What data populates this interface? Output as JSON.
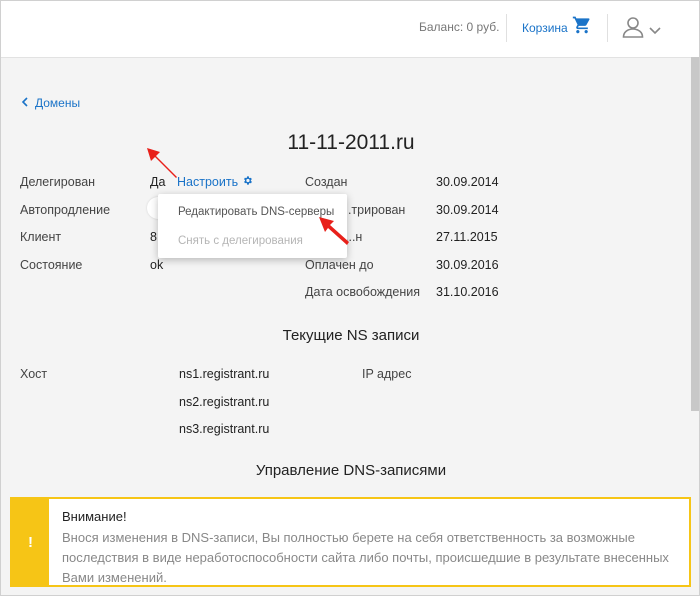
{
  "header": {
    "balance": "Баланс: 0 руб.",
    "cart_label": "Корзина"
  },
  "nav": {
    "back_label": "Домены"
  },
  "domain": {
    "title": "11-11-2011.ru"
  },
  "left_fields": [
    {
      "label": "Делегирован",
      "value": "Да"
    },
    {
      "label": "Автопродление",
      "value": ""
    },
    {
      "label": "Клиент",
      "value": "8"
    },
    {
      "label": "Состояние",
      "value": "ok"
    }
  ],
  "configure_link": "Настроить",
  "right_fields": [
    {
      "label": "Создан",
      "value": "30.09.2014"
    },
    {
      "label": "...трирован",
      "value": "30.09.2014"
    },
    {
      "label": "...н",
      "value": "27.11.2015"
    },
    {
      "label": "Оплачен до",
      "value": "30.09.2016"
    },
    {
      "label": "Дата освобождения",
      "value": "31.10.2016"
    }
  ],
  "dropdown": {
    "items": [
      {
        "label": "Редактировать DNS-серверы",
        "enabled": true
      },
      {
        "label": "Снять с делегирования",
        "enabled": false
      }
    ]
  },
  "ns_section": {
    "title": "Текущие NS записи",
    "host_label": "Хост",
    "ip_label": "IP адрес",
    "records": [
      "ns1.registrant.ru",
      "ns2.registrant.ru",
      "ns3.registrant.ru"
    ]
  },
  "dns_section": {
    "title": "Управление DNS-записями"
  },
  "alert": {
    "icon_text": "!",
    "title": "Внимание!",
    "text": "Внося изменения в DNS-записи, Вы полностью берете на себя ответственность за возможные последствия в виде неработоспособности сайта либо почты, происшедшие в результате внесенных Вами изменений."
  },
  "colors": {
    "accent": "#1a73c8",
    "warning": "#f6c516",
    "arrow": "#e8201a"
  },
  "icons": [
    "cart-icon",
    "user-icon",
    "chevron-down-icon",
    "chevron-left-icon",
    "gear-icon",
    "warning-icon",
    "red-arrow-pointer"
  ]
}
